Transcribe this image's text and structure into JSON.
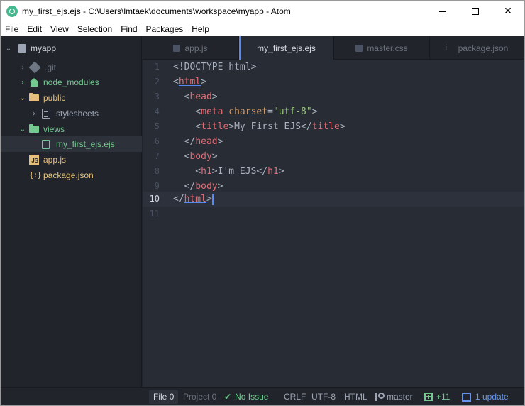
{
  "window": {
    "title": "my_first_ejs.ejs - C:\\Users\\lmtaek\\documents\\workspace\\myapp - Atom",
    "minimize_glyph": "",
    "close_glyph": "✕"
  },
  "menu": [
    "File",
    "Edit",
    "View",
    "Selection",
    "Find",
    "Packages",
    "Help"
  ],
  "tree": {
    "root": "myapp",
    "items": [
      {
        "label": "myapp",
        "icon": "repo-icon"
      },
      {
        "label": ".git",
        "icon": "git-icon"
      },
      {
        "label": "node_modules",
        "icon": "home-icon"
      },
      {
        "label": "public",
        "icon": "folder-icon"
      },
      {
        "label": "stylesheets",
        "icon": "css-folder-icon"
      },
      {
        "label": "views",
        "icon": "folder-icon"
      },
      {
        "label": "my_first_ejs.ejs",
        "icon": "file-icon"
      },
      {
        "label": "app.js",
        "icon": "js-icon"
      },
      {
        "label": "package.json",
        "icon": "json-icon"
      }
    ],
    "js_badge": "JS",
    "json_badge": "{:}"
  },
  "tabs": [
    {
      "label": "app.js",
      "icon": "js-icon",
      "active": false
    },
    {
      "label": "my_first_ejs.ejs",
      "icon": "",
      "active": true
    },
    {
      "label": "master.css",
      "icon": "css-icon",
      "active": false
    },
    {
      "label": "package.json",
      "icon": "settings-icon",
      "active": false
    }
  ],
  "editor": {
    "line_numbers": [
      "1",
      "2",
      "3",
      "4",
      "5",
      "6",
      "7",
      "8",
      "9",
      "10",
      "11"
    ],
    "current_line": "10",
    "lines": [
      "<!DOCTYPE html>",
      "<html>",
      "  <head>",
      "    <meta charset=\"utf-8\">",
      "    <title>My First EJS</title>",
      "  </head>",
      "  <body>",
      "    <h1>I'm EJS</h1>",
      "  </body>",
      "</html>",
      ""
    ]
  },
  "status": {
    "file": "File 0",
    "project": "Project 0",
    "issues": "No Issue",
    "line_ending": "CRLF",
    "encoding": "UTF-8",
    "grammar": "HTML",
    "branch": "master",
    "diff": "+11",
    "updates": "1 update"
  },
  "colors": {
    "background": "#282c34",
    "sidebar": "#21252b",
    "accent": "#568af2",
    "tag": "#e06c75",
    "attribute": "#d19a66",
    "string": "#98c379",
    "green": "#73c990",
    "json_yellow": "#e5c07b"
  }
}
